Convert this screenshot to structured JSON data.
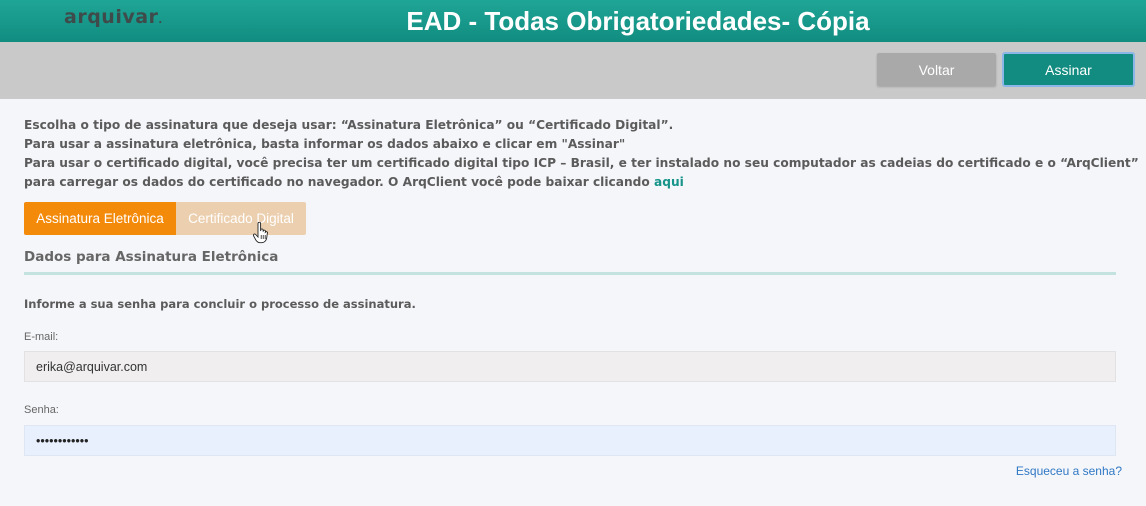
{
  "header": {
    "logo_text": "arquivar",
    "logo_mark": ".",
    "title": "EAD - Todas Obrigatoriedades- Cópia"
  },
  "toolbar": {
    "back_label": "Voltar",
    "sign_label": "Assinar"
  },
  "instructions": {
    "line1": "Escolha o tipo de assinatura que deseja usar: “Assinatura Eletrônica” ou “Certificado Digital”.",
    "line2": "Para usar a assinatura eletrônica, basta informar os dados abaixo e clicar em \"Assinar\"",
    "line3": "Para usar o certificado digital, você precisa ter um certificado digital tipo ICP – Brasil, e ter instalado no seu computador as cadeias do certificado e o “ArqClient”",
    "line4_prefix": "para carregar os dados do certificado no navegador. O ArqClient você pode baixar clicando ",
    "line4_link": "aqui"
  },
  "tabs": {
    "electronic_label": "Assinatura Eletrônica",
    "certificate_label": "Certificado Digital"
  },
  "form": {
    "section_title": "Dados para Assinatura Eletrônica",
    "info_text": "Informe a sua senha para concluir o processo de assinatura.",
    "email_label": "E-mail:",
    "email_value": "erika@arquivar.com",
    "password_label": "Senha:",
    "password_value": "••••••••••••",
    "forgot_link": "Esqueceu a senha?"
  },
  "colors": {
    "header_teal": "#1fa596",
    "sign_button": "#128c80",
    "tab_active": "#f48a0a",
    "tab_inactive": "#eccfaf",
    "link": "#16948a"
  },
  "icons": {
    "cursor": "hand-pointer-icon"
  }
}
